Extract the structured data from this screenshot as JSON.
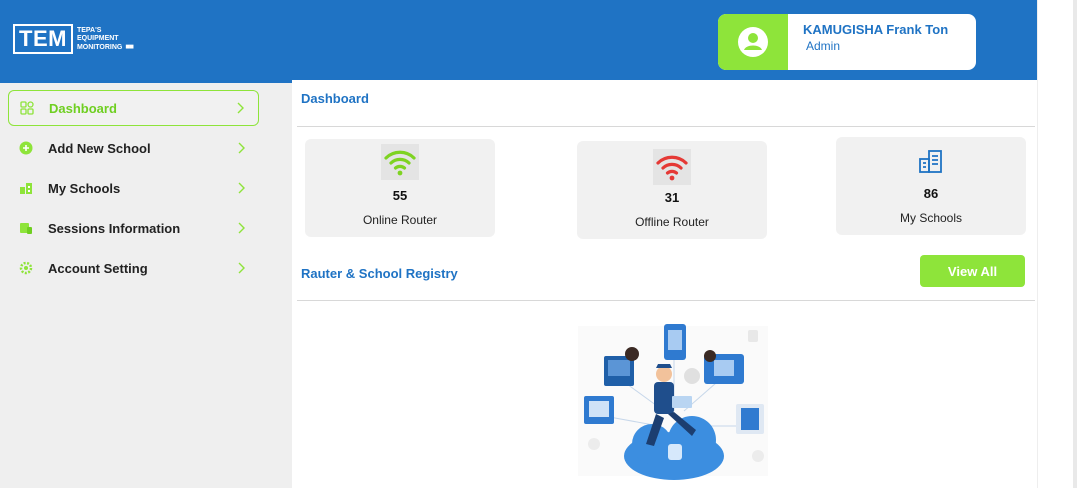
{
  "header": {
    "logo_main": "TEM",
    "logo_line1": "TEPA'S",
    "logo_line2": "EQUIPMENT",
    "logo_line3": "MONITORING",
    "user_name": "KAMUGISHA Frank Ton",
    "user_role": "Admin"
  },
  "sidebar": {
    "items": [
      {
        "label": "Dashboard",
        "icon": "dashboard-grid-icon",
        "active": true
      },
      {
        "label": "Add New School",
        "icon": "add-circle-icon",
        "active": false
      },
      {
        "label": "My Schools",
        "icon": "school-building-icon",
        "active": false
      },
      {
        "label": "Sessions Information",
        "icon": "sessions-icon",
        "active": false
      },
      {
        "label": "Account Setting",
        "icon": "settings-gear-icon",
        "active": false
      }
    ]
  },
  "main": {
    "title": "Dashboard",
    "stats": [
      {
        "value": "55",
        "label": "Online Router",
        "icon": "wifi-green-icon",
        "color": "#7ed321"
      },
      {
        "value": "31",
        "label": "Offline Router",
        "icon": "wifi-red-icon",
        "color": "#e53935"
      },
      {
        "value": "86",
        "label": "My Schools",
        "icon": "schools-blue-icon",
        "color": "#1f73c4"
      }
    ],
    "registry_title": "Rauter & School Registry",
    "view_all_label": "View All"
  },
  "colors": {
    "primary": "#1f73c4",
    "accent": "#8ee43a",
    "sidebar_bg": "#efefef",
    "card_bg": "#f1f1f1"
  }
}
